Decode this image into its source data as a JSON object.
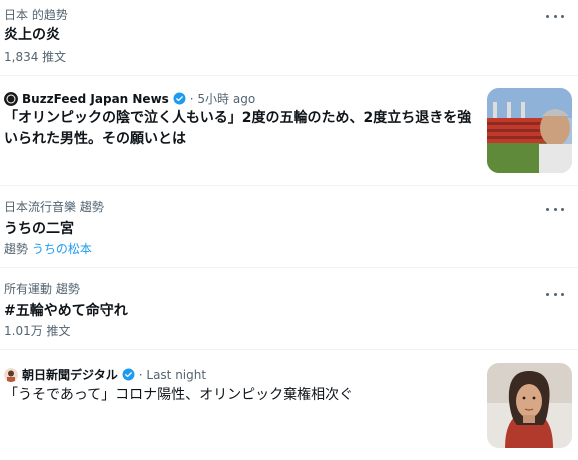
{
  "trends": [
    {
      "context": "日本 的趋势",
      "title": "炎上の炎",
      "meta": "1,834 推文"
    },
    {
      "context": "日本流行音樂 趨勢",
      "title": "うちの二宮",
      "meta_prefix": "趨勢",
      "meta_link": "うちの松本"
    },
    {
      "context": "所有運動 趨勢",
      "title": "#五輪やめて命守れ",
      "meta": "1.01万 推文"
    }
  ],
  "news": [
    {
      "source": "BuzzFeed Japan News",
      "time": "· 5小時 ago",
      "headline": "「オリンピックの陰で泣く人もいる」2度の五輪のため、2度立ち退きを強いられた男性。その願いとは",
      "thumbnail_icon": "stadium-photo"
    },
    {
      "source": "朝日新聞デジタル",
      "time": "· Last night",
      "headline": "「うそであって」コロナ陽性、オリンピック棄権相次ぐ",
      "thumbnail_icon": "athlete-photo"
    }
  ],
  "colors": {
    "accent": "#1d9bf0",
    "muted": "#536471",
    "text": "#0f1419"
  }
}
